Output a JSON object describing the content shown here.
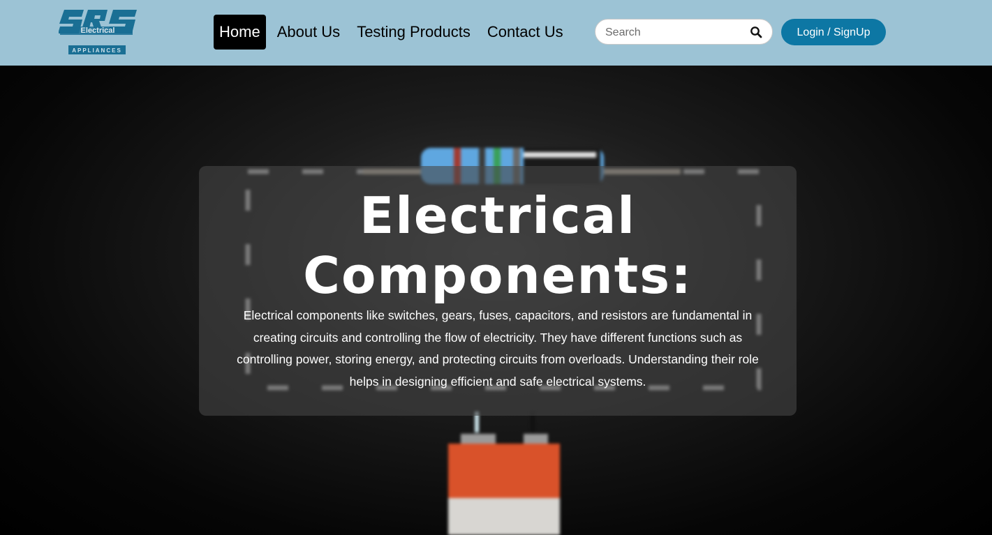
{
  "header": {
    "logo": {
      "text": "Electrical",
      "subtext": "APPLIANCES"
    },
    "nav": [
      {
        "label": "Home",
        "active": true
      },
      {
        "label": "About Us",
        "active": false
      },
      {
        "label": "Testing Products",
        "active": false
      },
      {
        "label": "Contact Us",
        "active": false
      }
    ],
    "search": {
      "placeholder": "Search",
      "icon": "search-icon"
    },
    "login_label": "Login / SignUp",
    "colors": {
      "navbar_bg": "#9cc3d5",
      "accent": "#0d77a4",
      "active_nav_bg": "#000000"
    }
  },
  "hero": {
    "title": "Electrical Components:",
    "text": "Electrical components like switches, gears, fuses, capacitors, and resistors are fundamental in creating circuits and controlling the flow of electricity. They have different functions such as controlling power, storing energy, and protecting circuits from overloads. Understanding their role helps in designing efficient and safe electrical systems."
  }
}
